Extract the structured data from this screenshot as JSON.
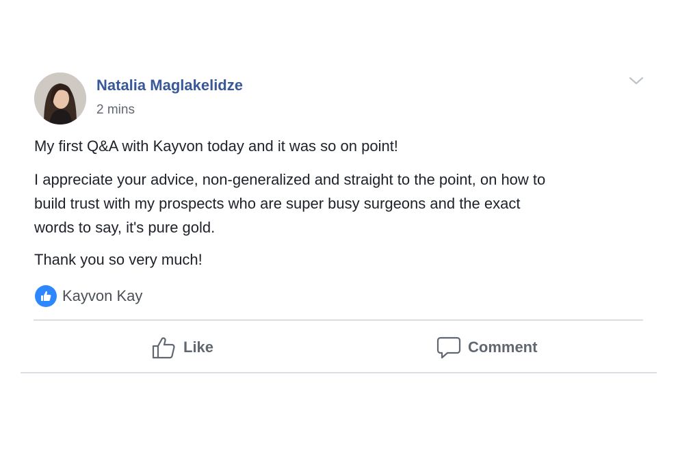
{
  "post": {
    "author": "Natalia Maglakelidze",
    "timestamp": "2 mins",
    "paragraphs": [
      "My first Q&A with Kayvon today and it was so on point!",
      "I appreciate your advice, non-generalized and straight to the point, on how to",
      "build trust with my prospects who are super busy surgeons and the exact",
      "words to say, it's pure gold.",
      "Thank you so very much!"
    ],
    "reaction_name": "Kayvon Kay"
  },
  "actions": {
    "like_label": "Like",
    "comment_label": "Comment"
  },
  "colors": {
    "author_link": "#385898",
    "like_badge": "#2d88ff",
    "divider": "#dadde1"
  }
}
